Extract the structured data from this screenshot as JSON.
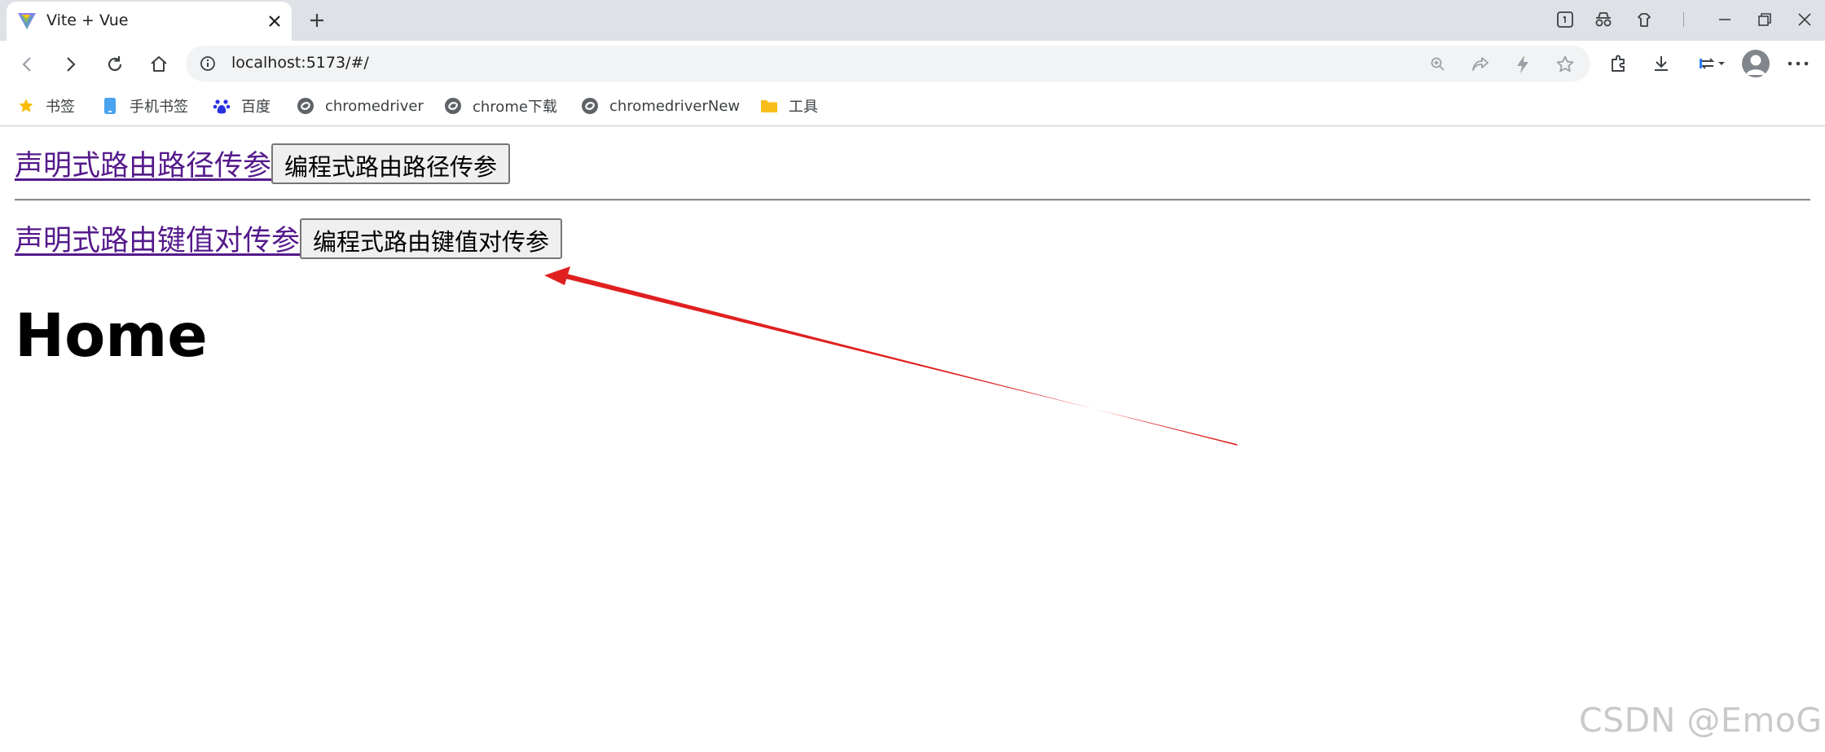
{
  "browser": {
    "tab": {
      "title": "Vite + Vue",
      "favicon": "vite-favicon"
    },
    "address_bar": {
      "url": "localhost:5173/#/"
    },
    "bookmarks": [
      {
        "label": "书签",
        "icon": "star-icon"
      },
      {
        "label": "手机书签",
        "icon": "phone-icon"
      },
      {
        "label": "百度",
        "icon": "baidu-paw-icon"
      },
      {
        "label": "chromedriver",
        "icon": "site-icon"
      },
      {
        "label": "chrome下载",
        "icon": "site-icon"
      },
      {
        "label": "chromedriverNew",
        "icon": "site-icon"
      },
      {
        "label": "工具",
        "icon": "folder-icon"
      }
    ],
    "colors": {
      "tabstrip": "#dee1e6",
      "omnibox": "#f1f3f4"
    }
  },
  "page": {
    "row1": {
      "link": "声明式路由路径传参",
      "button": "编程式路由路径传参"
    },
    "row2": {
      "link": "声明式路由键值对传参",
      "button": "编程式路由键值对传参"
    },
    "heading": "Home",
    "colors": {
      "visited_link": "#551a8b",
      "annotation_arrow": "#e02020"
    }
  },
  "watermark": "CSDN @EmoGP"
}
